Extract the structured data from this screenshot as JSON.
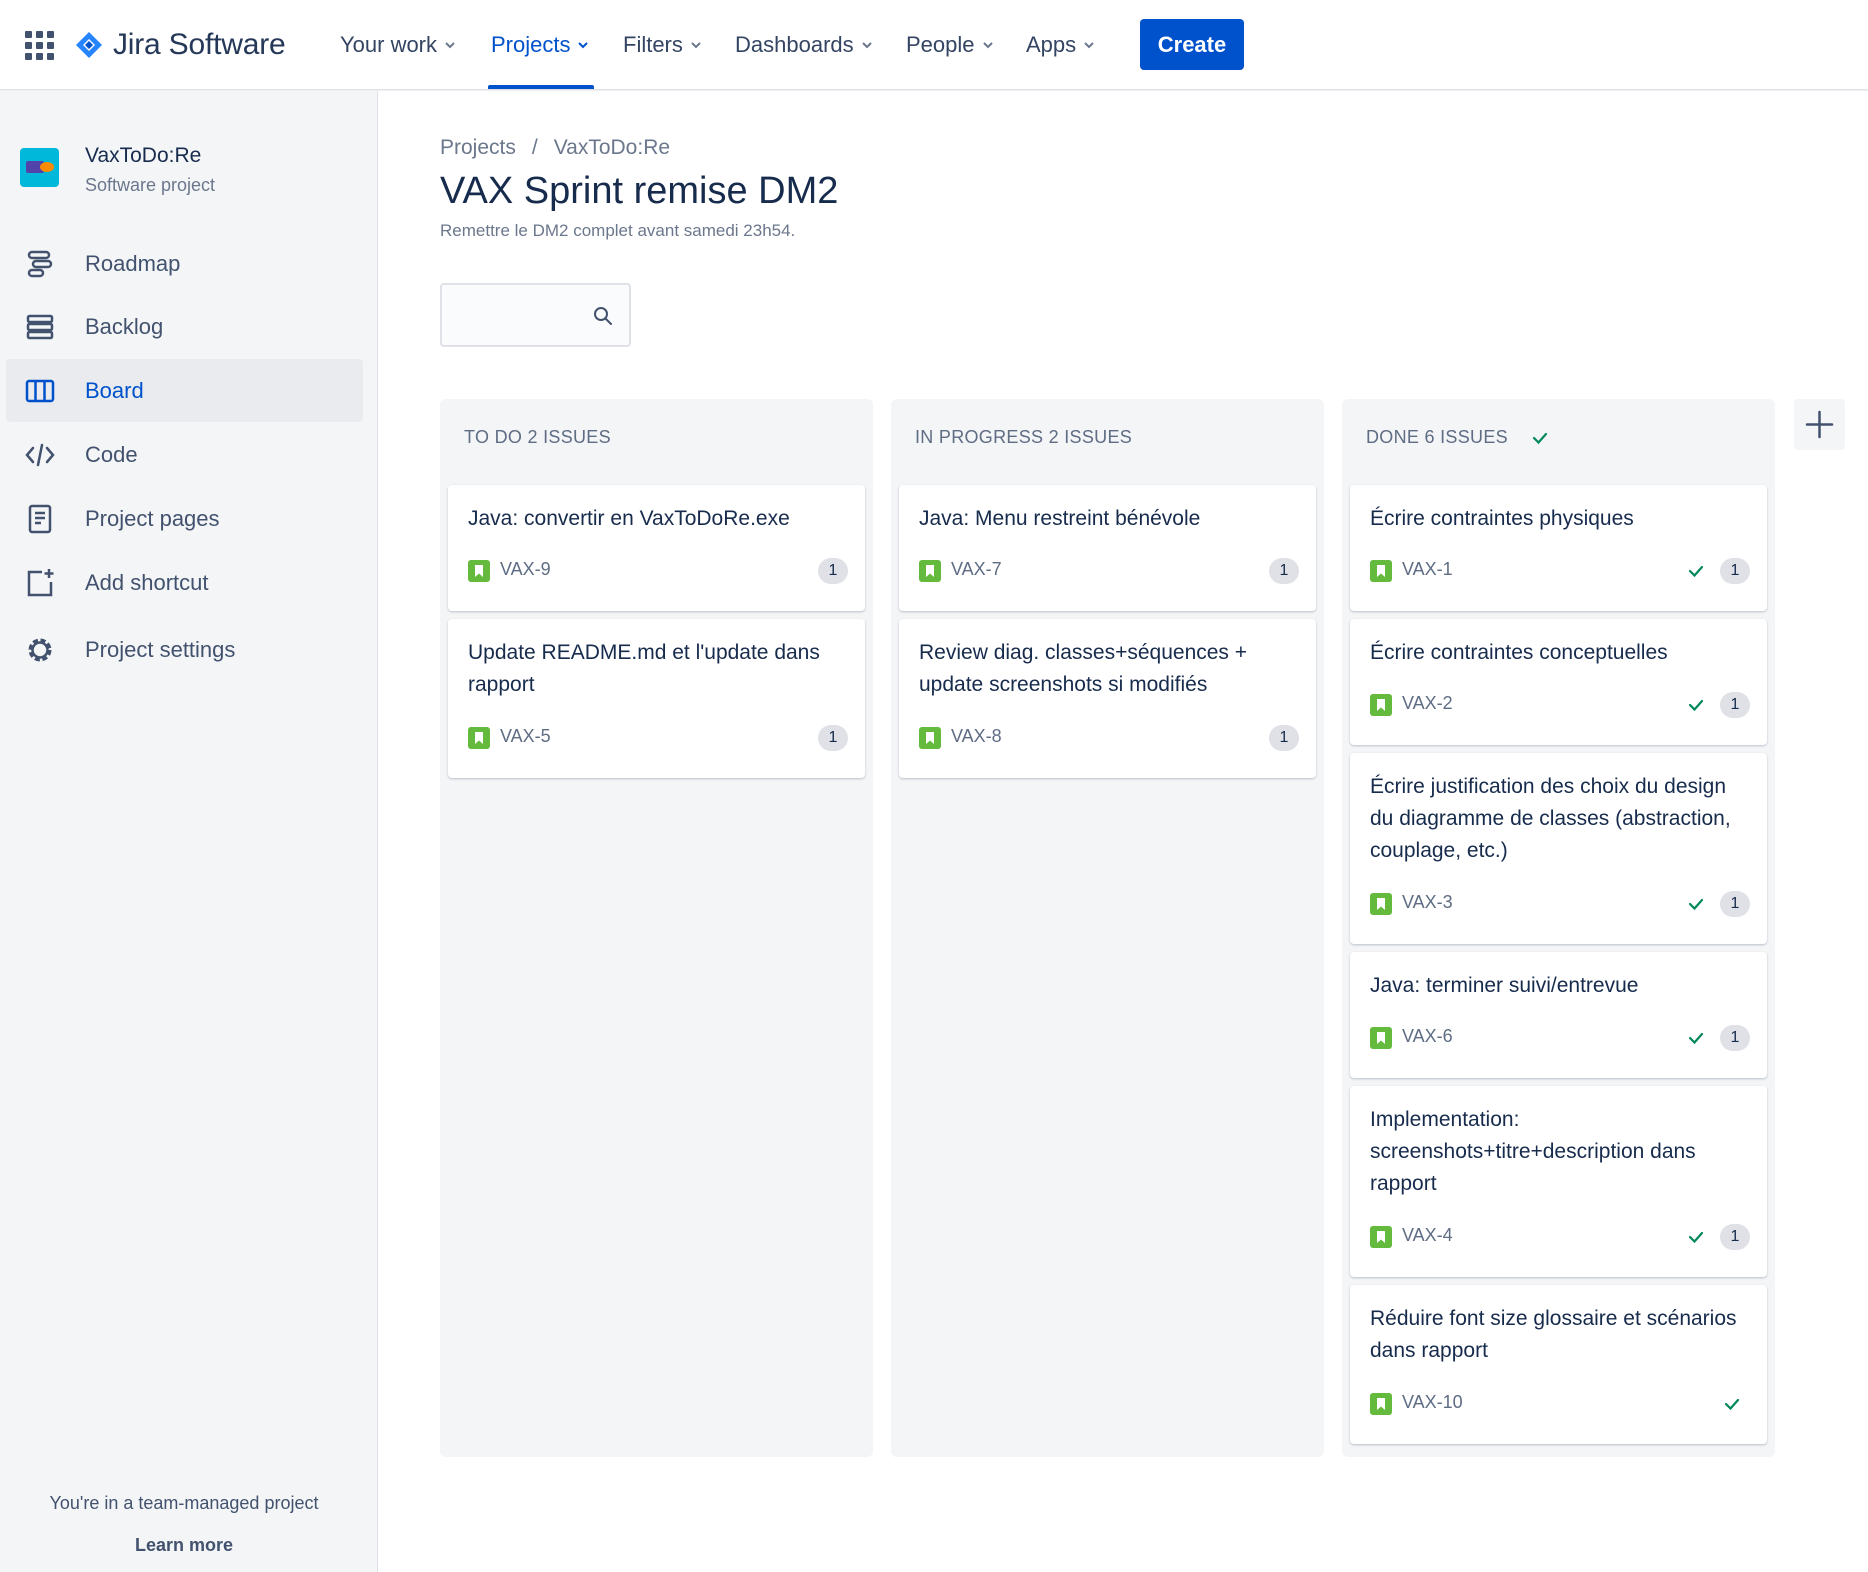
{
  "topnav": {
    "logo_text": "Jira Software",
    "items": [
      {
        "label": "Your work"
      },
      {
        "label": "Projects"
      },
      {
        "label": "Filters"
      },
      {
        "label": "Dashboards"
      },
      {
        "label": "People"
      },
      {
        "label": "Apps"
      }
    ],
    "active_item": "Projects",
    "create_label": "Create"
  },
  "sidebar": {
    "project_name": "VaxToDo:Re",
    "project_type": "Software project",
    "items": [
      {
        "label": "Roadmap",
        "icon": "roadmap-icon"
      },
      {
        "label": "Backlog",
        "icon": "backlog-icon"
      },
      {
        "label": "Board",
        "icon": "board-icon"
      },
      {
        "label": "Code",
        "icon": "code-icon"
      },
      {
        "label": "Project pages",
        "icon": "page-icon"
      },
      {
        "label": "Add shortcut",
        "icon": "add-shortcut-icon"
      },
      {
        "label": "Project settings",
        "icon": "gear-icon"
      }
    ],
    "active_item": "Board",
    "footer_text": "You're in a team-managed project",
    "learn_more": "Learn more"
  },
  "main": {
    "breadcrumb": [
      "Projects",
      "VaxToDo:Re"
    ],
    "breadcrumb_sep": "/",
    "title": "VAX Sprint remise DM2",
    "subtitle": "Remettre le DM2 complet avant samedi 23h54.",
    "search_placeholder": ""
  },
  "columns": [
    {
      "header": "TO DO 2 ISSUES",
      "cards": [
        {
          "title": "Java: convertir en VaxToDoRe.exe",
          "key": "VAX-9",
          "estimate": "1"
        },
        {
          "title": "Update README.md et l'update dans rapport",
          "key": "VAX-5",
          "estimate": "1"
        }
      ]
    },
    {
      "header": "IN PROGRESS 2 ISSUES",
      "cards": [
        {
          "title": "Java: Menu restreint bénévole",
          "key": "VAX-7",
          "estimate": "1"
        },
        {
          "title": "Review diag. classes+séquences + update screenshots si modifiés",
          "key": "VAX-8",
          "estimate": "1"
        }
      ]
    },
    {
      "header": "DONE 6 ISSUES",
      "cards": [
        {
          "title": "Écrire contraintes physiques",
          "key": "VAX-1",
          "estimate": "1"
        },
        {
          "title": "Écrire contraintes conceptuelles",
          "key": "VAX-2",
          "estimate": "1"
        },
        {
          "title": "Écrire justification des choix du design du diagramme de classes (abstraction, couplage, etc.)",
          "key": "VAX-3",
          "estimate": "1"
        },
        {
          "title": "Java: terminer suivi/entrevue",
          "key": "VAX-6",
          "estimate": "1"
        },
        {
          "title": "Implementation: screenshots+titre+description dans rapport",
          "key": "VAX-4",
          "estimate": "1"
        },
        {
          "title": "Réduire font size glossaire et scénarios dans rapport",
          "key": "VAX-10",
          "estimate": ""
        }
      ]
    }
  ],
  "colors": {
    "brand_blue": "#0052cc",
    "story_green": "#63ba3c",
    "done_green": "#00875a",
    "sidebar_bg": "#f4f5f7"
  }
}
